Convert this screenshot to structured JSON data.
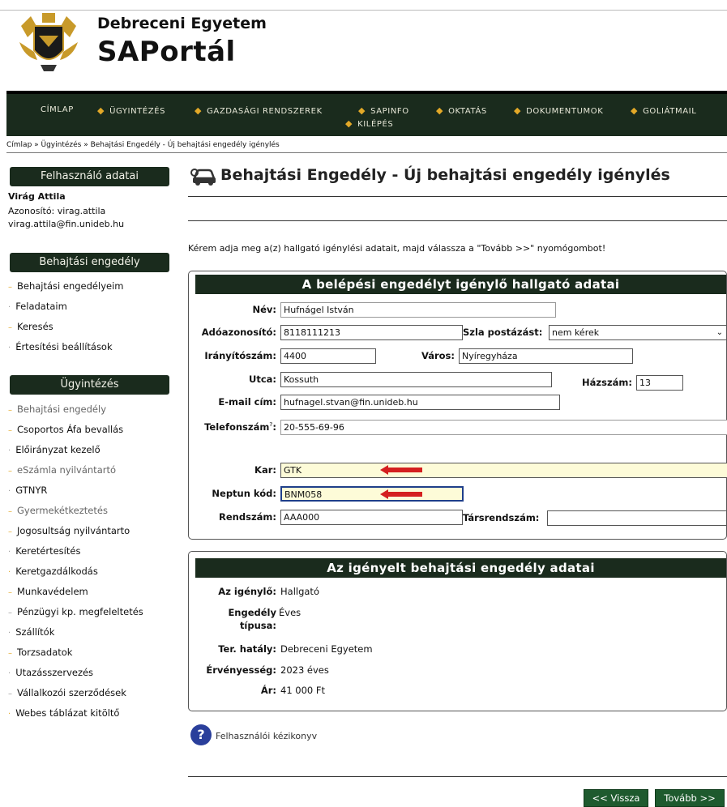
{
  "header": {
    "university": "Debreceni Egyetem",
    "portal": "SAPortál"
  },
  "nav": {
    "items": [
      "CÍMLAP",
      "ÜGYINTÉZÉS",
      "GAZDASÁGI RENDSZEREK",
      "SAPINFO",
      "OKTATÁS",
      "DOKUMENTUMOK",
      "GOLIÁTMAIL",
      "KILÉPÉS"
    ]
  },
  "breadcrumb": "Címlap » Ügyintézés » Behajtási Engedély - Új behajtási engedély igénylés",
  "sidebar": {
    "user_title": "Felhasználó adatai",
    "user_name": "Virág Attila",
    "user_id": "Azonosító: virag.attila",
    "user_email": "virag.attila@fin.unideb.hu",
    "permit_title": "Behajtási engedély",
    "permit_items": [
      "Behajtási engedélyeim",
      "Feladataim",
      "Keresés",
      "Értesítési beállítások"
    ],
    "admin_title": "Ügyintézés",
    "admin_items": [
      "Behajtási engedély",
      "Csoportos Áfa bevallás",
      "Előirányzat kezelő",
      "eSzámla nyilvántartó",
      "GTNYR",
      "Gyermekétkeztetés",
      "Jogosultság nyilvántarto",
      "Keretértesítés",
      "Keretgazdálkodás",
      "Munkavédelem",
      "Pénzügyi kp. megfeleltetés",
      "Szállítók",
      "Torzsadatok",
      "Utazásszervezés",
      "Vállalkozói szerződések",
      "Webes táblázat kitöltő"
    ]
  },
  "main": {
    "title": "Behajtási Engedély - Új behajtási engedély igénylés",
    "instruction": "Kérem adja meg a(z) hallgató igénylési adatait, majd válassza a \"Tovább >>\" nyomógombot!",
    "student_panel": {
      "heading": "A belépési engedélyt igénylő hallgató adatai",
      "labels": {
        "name": "Név:",
        "tax_id": "Adóazonosító:",
        "invoice_post": "Szla postázást:",
        "zip": "Irányítószám:",
        "city": "Város:",
        "street": "Utca:",
        "house": "Házszám:",
        "email": "E-mail cím:",
        "phone": "Telefonszám",
        "phone_sup": "?",
        "faculty": "Kar:",
        "neptun": "Neptun kód:",
        "plate": "Rendszám:",
        "co_plate": "Társrendszám:"
      },
      "values": {
        "name": "Hufnágel István",
        "tax_id": "8118111213",
        "invoice_post": "nem kérek",
        "zip": "4400",
        "city": "Nyíregyháza",
        "street": "Kossuth",
        "house": "13",
        "email": "hufnagel.stvan@fin.unideb.hu",
        "phone": "20-555-69-96",
        "faculty": "GTK",
        "neptun": "BNM058",
        "plate": "AAA000",
        "co_plate": ""
      }
    },
    "permit_panel": {
      "heading": "Az igényelt behajtási engedély adatai",
      "labels": {
        "requester": "Az igénylő:",
        "type_1": "Engedély",
        "type_2": "típusa:",
        "scope": "Ter. hatály:",
        "validity": "Érvényesség:",
        "price": "Ár:"
      },
      "values": {
        "requester": "Hallgató",
        "type": "Éves",
        "scope": "Debreceni Egyetem",
        "validity": "2023 éves",
        "price": "41 000 Ft"
      }
    },
    "help_text": "Felhasználói kézikonyv",
    "buttons": {
      "back": "<< Vissza",
      "next": "Tovább >>"
    }
  },
  "colors": {
    "nav_bg": "#1a2b1d",
    "accent": "#e3a928",
    "arrow": "#d42020",
    "button": "#1e5a2e"
  }
}
